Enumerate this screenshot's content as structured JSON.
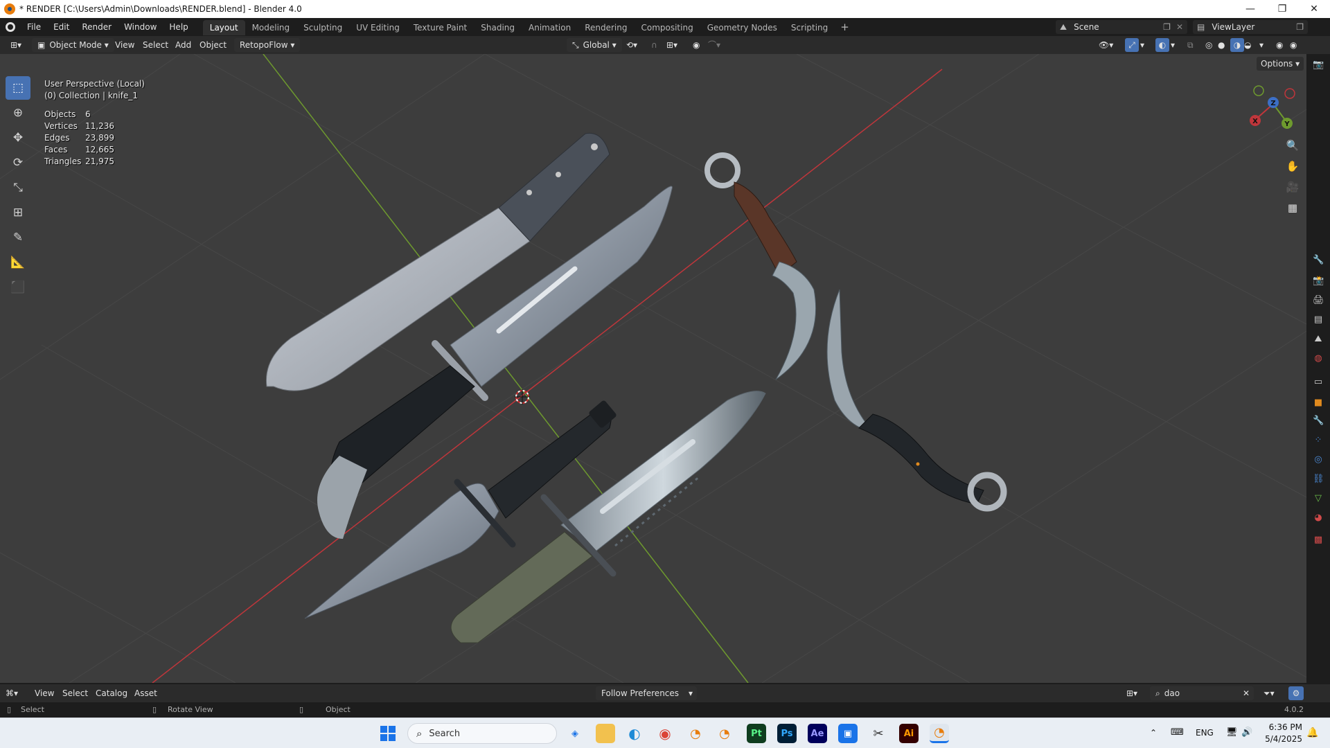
{
  "window": {
    "title": "* RENDER [C:\\Users\\Admin\\Downloads\\RENDER.blend] - Blender 4.0",
    "controls": [
      "—",
      "❐",
      "✕"
    ]
  },
  "menu": {
    "items": [
      "File",
      "Edit",
      "Render",
      "Window",
      "Help"
    ],
    "workspaces": [
      "Layout",
      "Modeling",
      "Sculpting",
      "UV Editing",
      "Texture Paint",
      "Shading",
      "Animation",
      "Rendering",
      "Compositing",
      "Geometry Nodes",
      "Scripting"
    ],
    "active_workspace": "Layout",
    "add_tab": "+",
    "scene": "Scene",
    "view_layer": "ViewLayer"
  },
  "viewport_header": {
    "mode": "Object Mode",
    "menus": [
      "View",
      "Select",
      "Add",
      "Object"
    ],
    "addon": "RetopoFlow",
    "orientation": "Global",
    "options": "Options"
  },
  "overlay": {
    "view_name": "User Perspective (Local)",
    "collection": "(0) Collection | knife_1",
    "stats": [
      {
        "label": "Objects",
        "value": "6"
      },
      {
        "label": "Vertices",
        "value": "11,236"
      },
      {
        "label": "Edges",
        "value": "23,899"
      },
      {
        "label": "Faces",
        "value": "12,665"
      },
      {
        "label": "Triangles",
        "value": "21,975"
      }
    ]
  },
  "gizmo": {
    "x": "X",
    "y": "Y",
    "z": "Z"
  },
  "asset_bar": {
    "menus": [
      "View",
      "Select",
      "Catalog",
      "Asset"
    ],
    "import_method": "Follow Preferences",
    "search_value": "dao"
  },
  "status_bar": {
    "items": [
      "Select",
      "Rotate View",
      "Object"
    ],
    "version": "4.0.2"
  },
  "taskbar": {
    "search_placeholder": "Search",
    "apps": [
      "Pt",
      "Ps",
      "Ae",
      "Ai"
    ],
    "lang": "ENG",
    "time": "6:36 PM",
    "date": "5/4/2025"
  },
  "colors": {
    "accent": "#4772b3",
    "x_axis": "#c0363b",
    "y_axis": "#6e9a2e",
    "viewport_bg": "#3d3d3d"
  }
}
